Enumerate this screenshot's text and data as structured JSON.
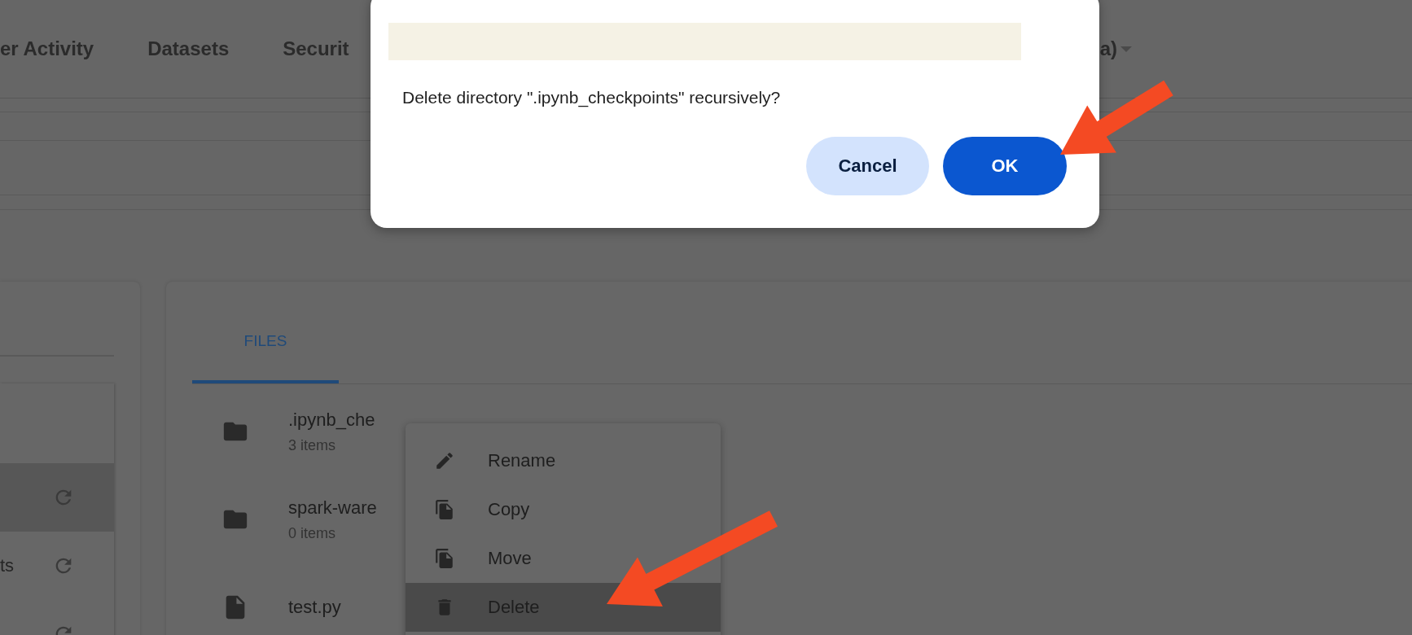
{
  "nav": {
    "items": [
      "er Activity",
      "Datasets",
      "Securit"
    ],
    "user": "a)"
  },
  "sidebar": {
    "rows": [
      {
        "selected": true
      },
      {
        "label": "ts",
        "selected": false
      },
      {
        "selected": false
      }
    ]
  },
  "tabs": [
    {
      "label": "FILES",
      "selected": true
    }
  ],
  "files": [
    {
      "name": ".ipynb_che",
      "detail": "3 items",
      "kind": "folder"
    },
    {
      "name": "spark-ware",
      "detail": "0 items",
      "kind": "folder"
    },
    {
      "name": "test.py",
      "kind": "file"
    }
  ],
  "context_menu": {
    "items": [
      {
        "label": "Rename",
        "kind": "rename",
        "selected": false
      },
      {
        "label": "Copy",
        "kind": "copy",
        "selected": false
      },
      {
        "label": "Move",
        "kind": "move",
        "selected": false
      },
      {
        "label": "Delete",
        "kind": "delete",
        "selected": true
      }
    ]
  },
  "dialog": {
    "message": "Delete directory \".ipynb_checkpoints\" recursively?",
    "buttons": [
      {
        "label": "Cancel",
        "kind": "secondary"
      },
      {
        "label": "OK",
        "kind": "primary"
      }
    ]
  }
}
